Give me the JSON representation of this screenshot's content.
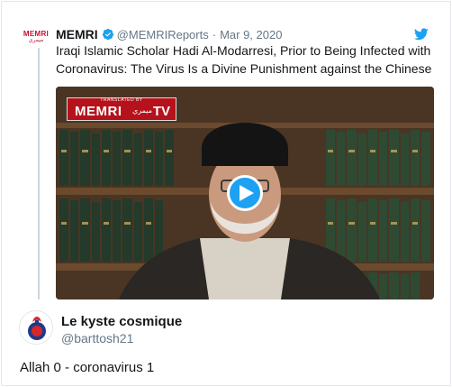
{
  "quoted_tweet": {
    "avatar_text_top": "MEMRI",
    "avatar_text_bottom": "ميمري",
    "name": "MEMRI",
    "handle": "@MEMRIReports",
    "separator": "·",
    "date": "Mar 9, 2020",
    "text_line1": "Iraqi Islamic Scholar Hadi Al-Modarresi, Prior to Being Infected with",
    "text_line2": "Coronavirus: The Virus Is a Divine Punishment against the Chinese",
    "video": {
      "logo_caption": "TRANSLATED BY",
      "logo_brand": "MEMRI",
      "logo_arabic": "ميمري",
      "logo_tv": "TV"
    }
  },
  "reply_tweet": {
    "name": "Le kyste cosmique",
    "handle": "@barttosh21",
    "text": "Allah 0 - coronavirus 1"
  },
  "colors": {
    "accent_blue": "#1da1f2",
    "memri_red": "#b5121b",
    "secondary_text": "#657786"
  },
  "icons": [
    "verified-badge-icon",
    "twitter-bird-icon",
    "play-icon"
  ]
}
